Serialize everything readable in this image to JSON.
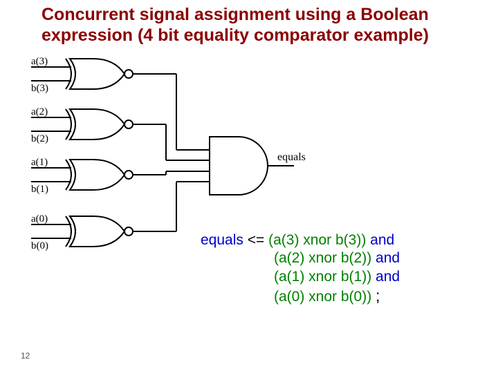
{
  "title_line1": "Concurrent signal assignment using a Boolean",
  "title_line2": "expression (4 bit equality comparator example)",
  "labels": {
    "a3": "a(3)",
    "b3": "b(3)",
    "a2": "a(2)",
    "b2": "b(2)",
    "a1": "a(1)",
    "b1": "b(1)",
    "a0": "a(0)",
    "b0": "b(0)",
    "out": "equals"
  },
  "code": {
    "sig": "equals",
    "assign": "<=",
    "l1_expr": "(a(3) xnor b(3))",
    "l2_expr": "(a(2) xnor b(2))",
    "l3_expr": "(a(1) xnor b(1))",
    "l4_expr": "(a(0) xnor b(0))",
    "and": "and",
    "semi": ";"
  },
  "page": "12"
}
